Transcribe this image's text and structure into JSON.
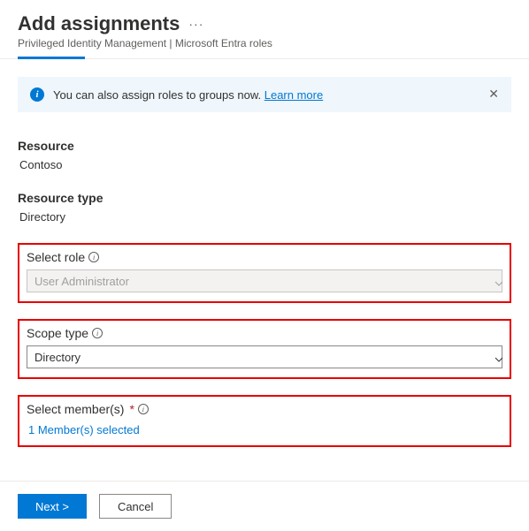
{
  "header": {
    "title": "Add assignments",
    "breadcrumb": "Privileged Identity Management | Microsoft Entra roles"
  },
  "banner": {
    "text": "You can also assign roles to groups now. ",
    "link": "Learn more"
  },
  "fields": {
    "resource": {
      "label": "Resource",
      "value": "Contoso"
    },
    "resource_type": {
      "label": "Resource type",
      "value": "Directory"
    },
    "select_role": {
      "label": "Select role",
      "value": "User Administrator"
    },
    "scope_type": {
      "label": "Scope type",
      "value": "Directory"
    },
    "select_members": {
      "label": "Select member(s)",
      "value": "1 Member(s) selected"
    }
  },
  "footer": {
    "next": "Next >",
    "cancel": "Cancel"
  }
}
